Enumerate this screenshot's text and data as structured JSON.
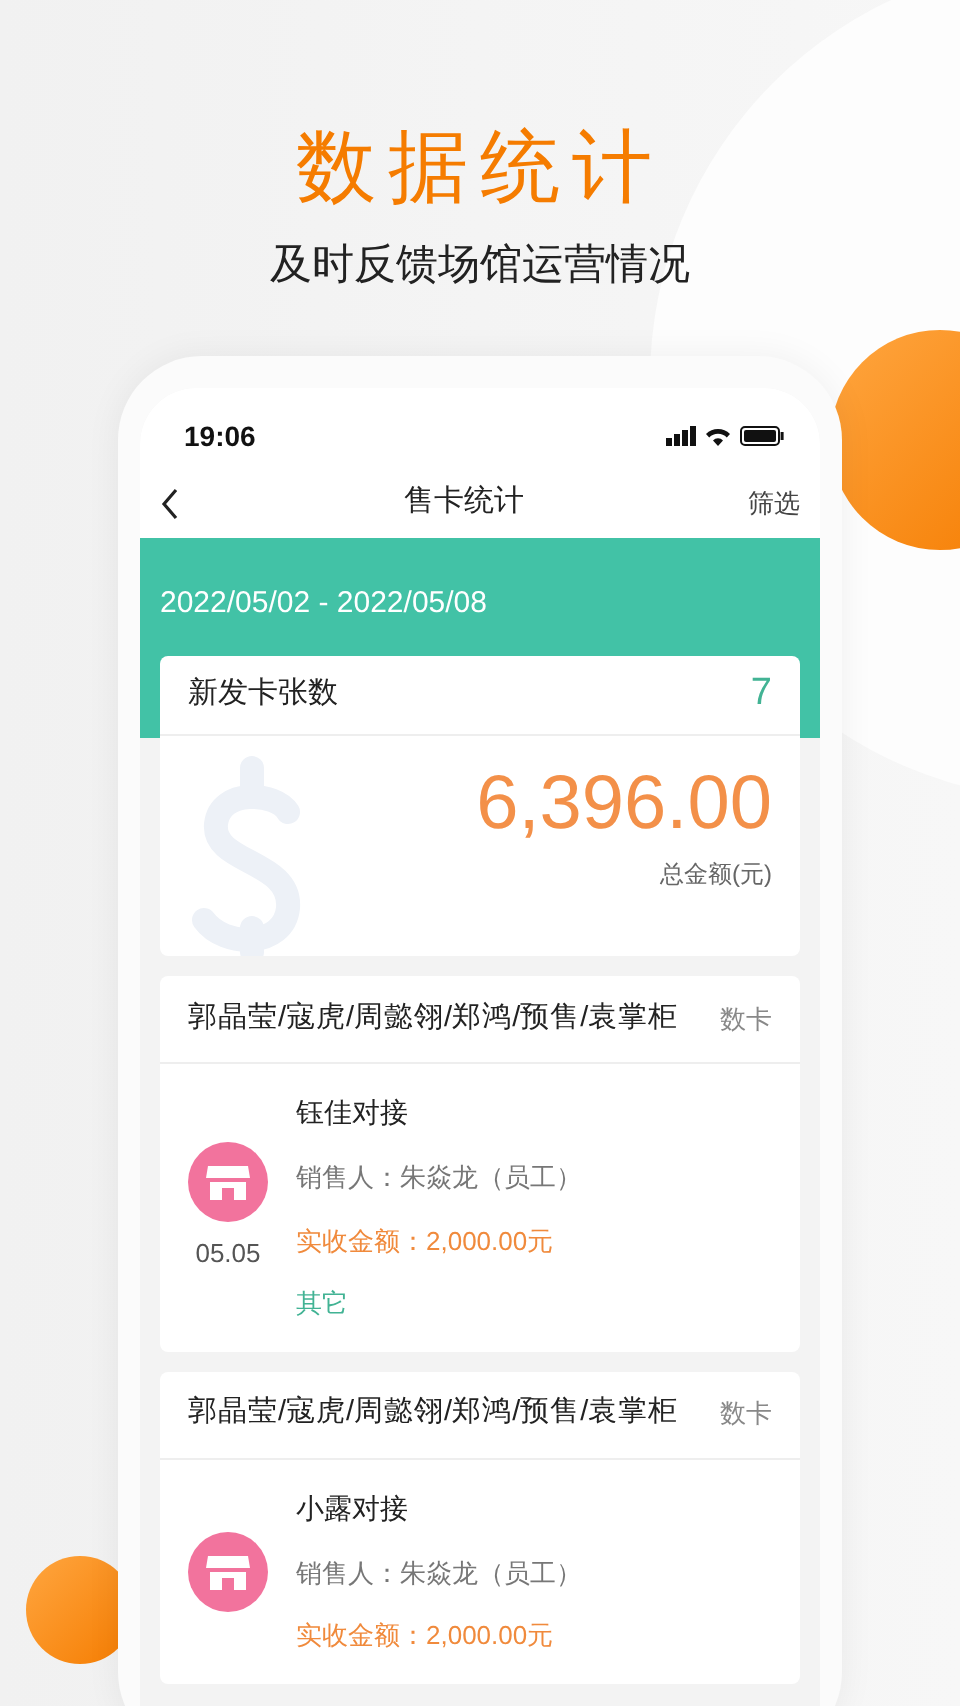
{
  "header": {
    "title": "数据统计",
    "subtitle": "及时反馈场馆运营情况"
  },
  "status_bar": {
    "time": "19:06"
  },
  "nav": {
    "title": "售卡统计",
    "action": "筛选"
  },
  "date_range": "2022/05/02 - 2022/05/08",
  "summary": {
    "label": "新发卡张数",
    "count": "7",
    "amount": "6,396.00",
    "amount_label": "总金额(元)"
  },
  "records": [
    {
      "title": "郭晶莹/寇虎/周懿翎/郑鸿/预售/袁掌柜",
      "card_type": "数卡",
      "name": "钰佳对接",
      "seller": "销售人：朱焱龙（员工）",
      "received": "实收金额：2,000.00元",
      "date": "05.05",
      "tag": "其它"
    },
    {
      "title": "郭晶莹/寇虎/周懿翎/郑鸿/预售/袁掌柜",
      "card_type": "数卡",
      "name": "小露对接",
      "seller": "销售人：朱焱龙（员工）",
      "received": "实收金额：2,000.00元"
    }
  ]
}
